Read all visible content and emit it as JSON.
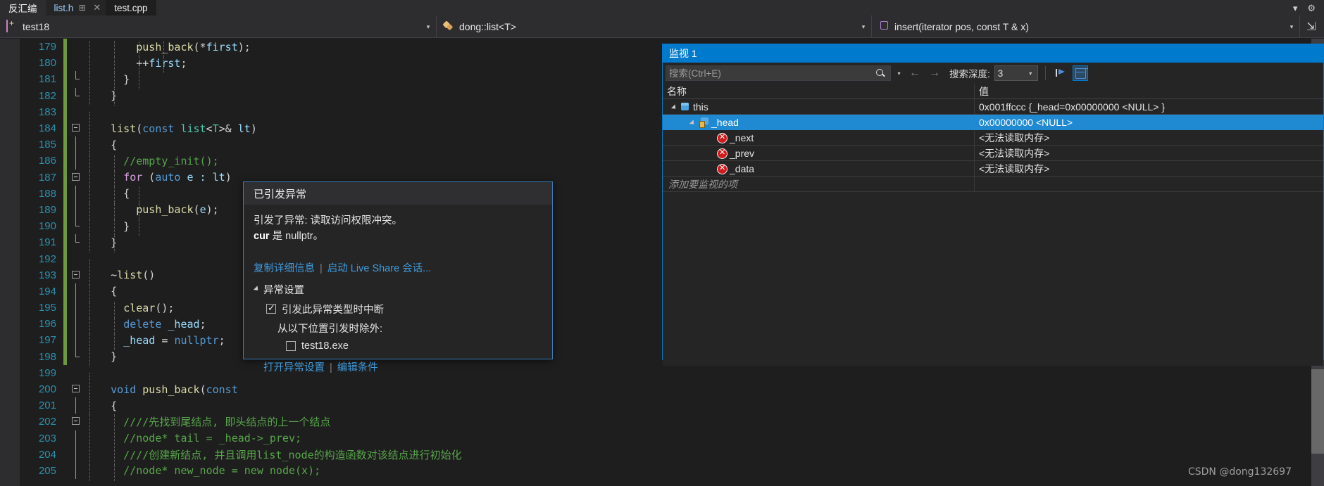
{
  "tabstrip": {
    "tabs": [
      {
        "label": "反汇编",
        "state": "inactive"
      },
      {
        "label": "list.h",
        "state": "active"
      },
      {
        "label": "test.cpp",
        "state": "third"
      }
    ],
    "pin_icon": "pin-icon",
    "close_icon": "close-icon",
    "chevron_label": "▾",
    "gear_label": "⚙"
  },
  "navbar": {
    "project": "test18",
    "scope": "dong::list<T>",
    "member": "insert(iterator pos, const T & x)",
    "caret": "▾",
    "split_label": "⇲"
  },
  "editor": {
    "lines": [
      {
        "no": "179",
        "indent": 4,
        "fold": "none",
        "saved": true,
        "tokens": [
          {
            "t": "        ",
            "c": "plain"
          },
          {
            "t": "push_back",
            "c": "fn"
          },
          {
            "t": "(*",
            "c": "punc"
          },
          {
            "t": "first",
            "c": "ident"
          },
          {
            "t": ");",
            "c": "punc"
          }
        ]
      },
      {
        "no": "180",
        "indent": 4,
        "fold": "none",
        "saved": true,
        "tokens": [
          {
            "t": "        ++",
            "c": "punc"
          },
          {
            "t": "first",
            "c": "ident"
          },
          {
            "t": ";",
            "c": "punc"
          }
        ]
      },
      {
        "no": "181",
        "indent": 3,
        "fold": "endhalf",
        "saved": true,
        "tokens": [
          {
            "t": "      }",
            "c": "punc"
          }
        ]
      },
      {
        "no": "182",
        "indent": 2,
        "fold": "endhalf",
        "saved": true,
        "tokens": [
          {
            "t": "    }",
            "c": "punc"
          }
        ]
      },
      {
        "no": "183",
        "indent": 1,
        "fold": "none",
        "saved": true,
        "tokens": [
          {
            "t": "",
            "c": "plain"
          }
        ]
      },
      {
        "no": "184",
        "indent": 1,
        "fold": "box",
        "saved": true,
        "tokens": [
          {
            "t": "    ",
            "c": "plain"
          },
          {
            "t": "list",
            "c": "fn"
          },
          {
            "t": "(",
            "c": "punc"
          },
          {
            "t": "const",
            "c": "kw"
          },
          {
            "t": " ",
            "c": "plain"
          },
          {
            "t": "list",
            "c": "type"
          },
          {
            "t": "<",
            "c": "punc"
          },
          {
            "t": "T",
            "c": "type"
          },
          {
            "t": ">& ",
            "c": "punc"
          },
          {
            "t": "lt",
            "c": "ident"
          },
          {
            "t": ")",
            "c": "punc"
          }
        ]
      },
      {
        "no": "185",
        "indent": 1,
        "fold": "line",
        "saved": true,
        "tokens": [
          {
            "t": "    {",
            "c": "punc"
          }
        ]
      },
      {
        "no": "186",
        "indent": 2,
        "fold": "line",
        "saved": true,
        "tokens": [
          {
            "t": "      //empty_init();",
            "c": "cmt"
          }
        ]
      },
      {
        "no": "187",
        "indent": 2,
        "fold": "box",
        "saved": true,
        "tokens": [
          {
            "t": "      ",
            "c": "plain"
          },
          {
            "t": "for",
            "c": "kwctl"
          },
          {
            "t": " (",
            "c": "punc"
          },
          {
            "t": "auto",
            "c": "kw"
          },
          {
            "t": " e : ",
            "c": "ident"
          },
          {
            "t": "lt",
            "c": "ident"
          },
          {
            "t": ")",
            "c": "punc"
          }
        ]
      },
      {
        "no": "188",
        "indent": 3,
        "fold": "line",
        "saved": true,
        "tokens": [
          {
            "t": "      {",
            "c": "punc"
          }
        ]
      },
      {
        "no": "189",
        "indent": 3,
        "fold": "line",
        "saved": true,
        "tokens": [
          {
            "t": "        ",
            "c": "plain"
          },
          {
            "t": "push_back",
            "c": "fn"
          },
          {
            "t": "(",
            "c": "punc"
          },
          {
            "t": "e",
            "c": "ident"
          },
          {
            "t": ");",
            "c": "punc"
          }
        ]
      },
      {
        "no": "190",
        "indent": 3,
        "fold": "endhalf",
        "saved": true,
        "tokens": [
          {
            "t": "      }",
            "c": "punc"
          }
        ]
      },
      {
        "no": "191",
        "indent": 2,
        "fold": "endhalf",
        "saved": true,
        "tokens": [
          {
            "t": "    }",
            "c": "punc"
          }
        ]
      },
      {
        "no": "192",
        "indent": 1,
        "fold": "none",
        "saved": true,
        "tokens": [
          {
            "t": "",
            "c": "plain"
          }
        ]
      },
      {
        "no": "193",
        "indent": 1,
        "fold": "box",
        "saved": true,
        "tokens": [
          {
            "t": "    ~",
            "c": "punc"
          },
          {
            "t": "list",
            "c": "fn"
          },
          {
            "t": "()",
            "c": "punc"
          }
        ]
      },
      {
        "no": "194",
        "indent": 1,
        "fold": "line",
        "saved": true,
        "tokens": [
          {
            "t": "    {",
            "c": "punc"
          }
        ]
      },
      {
        "no": "195",
        "indent": 2,
        "fold": "line",
        "saved": true,
        "tokens": [
          {
            "t": "      ",
            "c": "plain"
          },
          {
            "t": "clear",
            "c": "fn"
          },
          {
            "t": "();",
            "c": "punc"
          }
        ]
      },
      {
        "no": "196",
        "indent": 2,
        "fold": "line",
        "saved": true,
        "tokens": [
          {
            "t": "      ",
            "c": "plain"
          },
          {
            "t": "delete",
            "c": "kw"
          },
          {
            "t": " ",
            "c": "plain"
          },
          {
            "t": "_head",
            "c": "ident"
          },
          {
            "t": ";",
            "c": "punc"
          }
        ]
      },
      {
        "no": "197",
        "indent": 2,
        "fold": "line",
        "saved": true,
        "tokens": [
          {
            "t": "      ",
            "c": "plain"
          },
          {
            "t": "_head",
            "c": "ident"
          },
          {
            "t": " = ",
            "c": "punc"
          },
          {
            "t": "nullptr",
            "c": "kw"
          },
          {
            "t": ";",
            "c": "punc"
          }
        ]
      },
      {
        "no": "198",
        "indent": 1,
        "fold": "endhalf",
        "saved": true,
        "tokens": [
          {
            "t": "    }",
            "c": "punc"
          }
        ]
      },
      {
        "no": "199",
        "indent": 1,
        "fold": "none",
        "saved": false,
        "tokens": [
          {
            "t": "",
            "c": "plain"
          }
        ]
      },
      {
        "no": "200",
        "indent": 1,
        "fold": "box",
        "saved": false,
        "tokens": [
          {
            "t": "    ",
            "c": "plain"
          },
          {
            "t": "void",
            "c": "kw"
          },
          {
            "t": " ",
            "c": "plain"
          },
          {
            "t": "push_back",
            "c": "fn"
          },
          {
            "t": "(",
            "c": "punc"
          },
          {
            "t": "const",
            "c": "kw"
          }
        ]
      },
      {
        "no": "201",
        "indent": 1,
        "fold": "line",
        "saved": false,
        "tokens": [
          {
            "t": "    {",
            "c": "punc"
          }
        ]
      },
      {
        "no": "202",
        "indent": 2,
        "fold": "box",
        "saved": false,
        "tokens": [
          {
            "t": "      ////先找到尾结点, 即头结点的上一个结点",
            "c": "cmt"
          }
        ]
      },
      {
        "no": "203",
        "indent": 2,
        "fold": "line",
        "saved": false,
        "tokens": [
          {
            "t": "      //node* tail = _head->_prev;",
            "c": "cmt"
          }
        ]
      },
      {
        "no": "204",
        "indent": 2,
        "fold": "line",
        "saved": false,
        "tokens": [
          {
            "t": "      ////创建新结点, 并且调用list_node的构造函数对该结点进行初始化",
            "c": "cmt"
          }
        ]
      },
      {
        "no": "205",
        "indent": 2,
        "fold": "line",
        "saved": false,
        "tokens": [
          {
            "t": "      //node* new_node = new node(x);",
            "c": "cmt"
          }
        ]
      }
    ]
  },
  "exception": {
    "title": "已引发异常",
    "message_line1": "引发了异常: 读取访问权限冲突。",
    "message_bold": "cur",
    "message_line2_rest": " 是 nullptr。",
    "link_copy": "复制详细信息",
    "link_liveshare": "启动 Live Share 会话...",
    "separator": "|",
    "settings_header": "异常设置",
    "break_checkbox_label": "引发此异常类型时中断",
    "break_checkbox_checked": true,
    "except_from_label": "从以下位置引发时除外:",
    "exe_label": "test18.exe",
    "exe_checked": false,
    "link_open_settings": "打开异常设置",
    "link_edit_conditions": "编辑条件"
  },
  "watch": {
    "title": "监视 1",
    "search_placeholder": "搜索(Ctrl+E)",
    "search_value": "",
    "search_icon": "search-icon",
    "dropdown_caret": "▾",
    "back_arrow": "←",
    "forward_arrow": "→",
    "depth_label": "搜索深度:",
    "depth_value": "3",
    "columns": {
      "name": "名称",
      "value": "值"
    },
    "rows": [
      {
        "name": "this",
        "value": "0x001ffccc {_head=0x00000000 <NULL> }",
        "depth": 0,
        "icon": "cube-icon",
        "expander": "expanded",
        "selected": false
      },
      {
        "name": "_head",
        "value": "0x00000000 <NULL>",
        "depth": 1,
        "icon": "lock-cube-icon",
        "expander": "expanded",
        "selected": true
      },
      {
        "name": "_next",
        "value": "<无法读取内存>",
        "depth": 2,
        "icon": "error-icon",
        "expander": "none",
        "selected": false
      },
      {
        "name": "_prev",
        "value": "<无法读取内存>",
        "depth": 2,
        "icon": "error-icon",
        "expander": "none",
        "selected": false
      },
      {
        "name": "_data",
        "value": "<无法读取内存>",
        "depth": 2,
        "icon": "error-icon",
        "expander": "none",
        "selected": false
      }
    ],
    "add_item_placeholder": "添加要监视的项"
  },
  "watermark": "CSDN @dong132697",
  "colors": {
    "accent_blue": "#007acc",
    "selection_blue": "#1f8ad2",
    "link_blue": "#3f9bdc",
    "editor_bg": "#1e1e1e",
    "chrome_bg": "#2d2d30",
    "saved_change_green": "#6d9a3e",
    "error_red": "#d11a1a"
  }
}
